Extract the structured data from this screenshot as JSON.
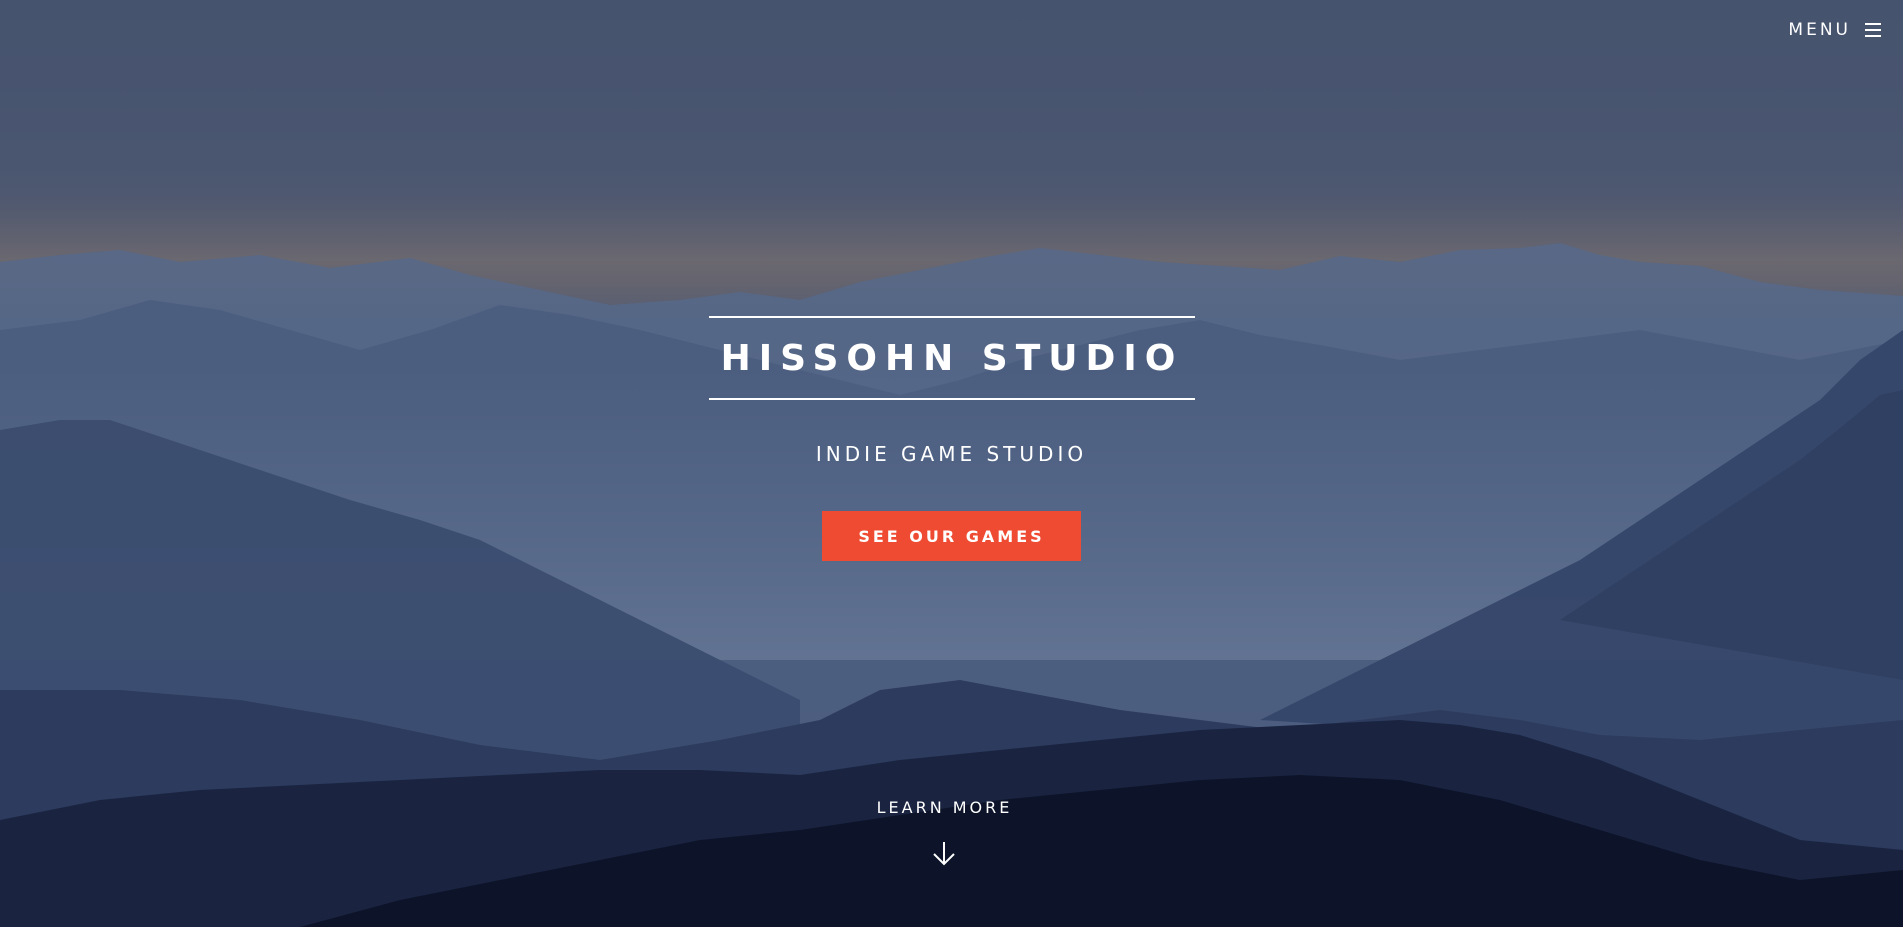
{
  "header": {
    "menu_label": "MENU",
    "menu_icon": "hamburger-icon"
  },
  "hero": {
    "title": "HISSOHN STUDIO",
    "subtitle": "INDIE GAME STUDIO",
    "cta_label": "SEE OUR GAMES",
    "learn_more_label": "LEARN MORE",
    "scroll_icon": "arrow-down-icon"
  },
  "colors": {
    "accent": "#ee4b32",
    "text": "#ffffff",
    "sky": "#46536e",
    "mountains_dark": "#0b1020"
  }
}
